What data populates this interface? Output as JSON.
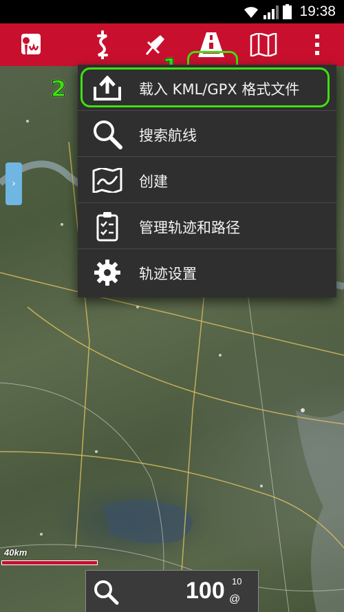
{
  "status_bar": {
    "time": "19:38"
  },
  "toolbar": {
    "items": [
      {
        "name": "logo",
        "icon": "app-logo-icon"
      },
      {
        "name": "route",
        "icon": "route-icon"
      },
      {
        "name": "waypoint",
        "icon": "pin-icon"
      },
      {
        "name": "tracks",
        "icon": "road-icon",
        "highlighted": true
      },
      {
        "name": "maps",
        "icon": "map-icon"
      },
      {
        "name": "more",
        "icon": "overflow-menu-icon"
      }
    ],
    "accent_color": "#c8102e"
  },
  "annotations": {
    "step1": "1",
    "step2": "2",
    "highlight_color": "#3fe012"
  },
  "menu": {
    "items": [
      {
        "label": "载入 KML/GPX 格式文件",
        "icon": "upload-icon",
        "highlighted": true
      },
      {
        "label": "搜索航线",
        "icon": "search-icon"
      },
      {
        "label": "创建",
        "icon": "map-draw-icon"
      },
      {
        "label": "管理轨迹和路径",
        "icon": "clipboard-check-icon"
      },
      {
        "label": "轨迹设置",
        "icon": "gear-icon"
      }
    ]
  },
  "map": {
    "scale_label": "40km"
  },
  "zoom": {
    "value": "100",
    "superscript": "10",
    "unit": "@"
  }
}
